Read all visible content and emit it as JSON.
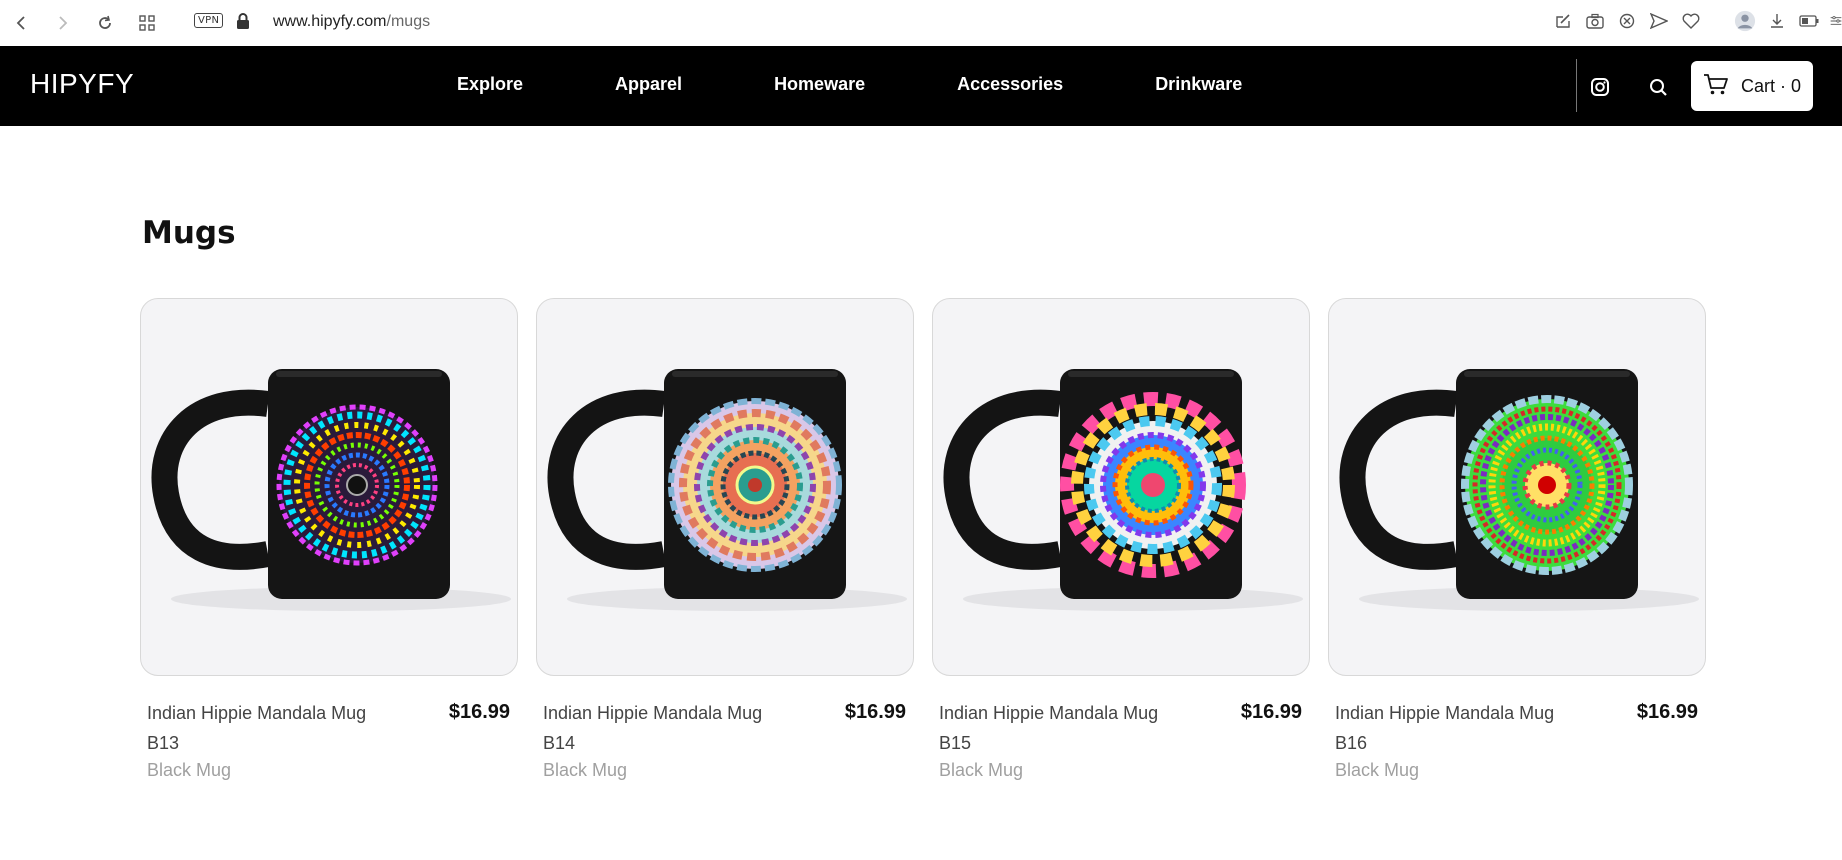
{
  "browser": {
    "vpn_label": "VPN",
    "url_domain": "www.hipyfy.com",
    "url_path": "/mugs"
  },
  "header": {
    "logo": "HIPYFY",
    "nav": [
      {
        "label": "Explore"
      },
      {
        "label": "Apparel"
      },
      {
        "label": "Homeware"
      },
      {
        "label": "Accessories"
      },
      {
        "label": "Drinkware"
      }
    ],
    "cart_label": "Cart · 0"
  },
  "main": {
    "title": "Mugs",
    "products": [
      {
        "name": "Indian Hippie Mandala Mug B13",
        "price": "$16.99",
        "subtitle": "Black Mug",
        "pattern": "hypnotic-rainbow-diamonds"
      },
      {
        "name": "Indian Hippie Mandala Mug B14",
        "price": "$16.99",
        "subtitle": "Black Mug",
        "pattern": "pastel-flower-mandala"
      },
      {
        "name": "Indian Hippie Mandala Mug B15",
        "price": "$16.99",
        "subtitle": "Black Mug",
        "pattern": "petal-star-mandala"
      },
      {
        "name": "Indian Hippie Mandala Mug B16",
        "price": "$16.99",
        "subtitle": "Black Mug",
        "pattern": "green-rainbow-rings"
      }
    ]
  },
  "colors": {
    "header_bg": "#000000",
    "card_bg": "#f4f4f6",
    "mug": "#111111"
  }
}
